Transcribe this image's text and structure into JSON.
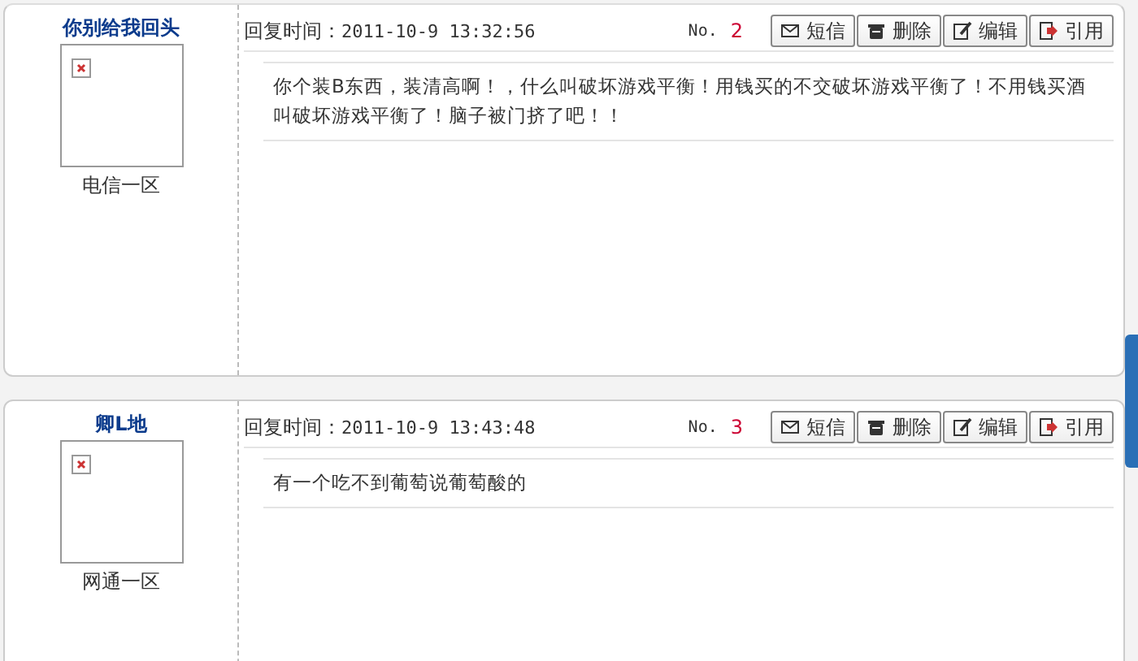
{
  "posts": [
    {
      "author": "你别给我回头",
      "region": "电信一区",
      "reply_label": "回复时间：",
      "time": "2011-10-9 13:32:56",
      "no_label": "No.",
      "floor": "2",
      "buttons": [
        {
          "kind": "message",
          "label": "短信"
        },
        {
          "kind": "delete",
          "label": "删除"
        },
        {
          "kind": "edit",
          "label": "编辑"
        },
        {
          "kind": "quote",
          "label": "引用"
        }
      ],
      "content": "你个装B东西，装清高啊！，什么叫破坏游戏平衡！用钱买的不交破坏游戏平衡了！不用钱买酒叫破坏游戏平衡了！脑子被门挤了吧！！"
    },
    {
      "author": "卿L地",
      "region": "网通一区",
      "reply_label": "回复时间：",
      "time": "2011-10-9 13:43:48",
      "no_label": "No.",
      "floor": "3",
      "buttons": [
        {
          "kind": "message",
          "label": "短信"
        },
        {
          "kind": "delete",
          "label": "删除"
        },
        {
          "kind": "edit",
          "label": "编辑"
        },
        {
          "kind": "quote",
          "label": "引用"
        }
      ],
      "content": "有一个吃不到葡萄说葡萄酸的"
    }
  ]
}
